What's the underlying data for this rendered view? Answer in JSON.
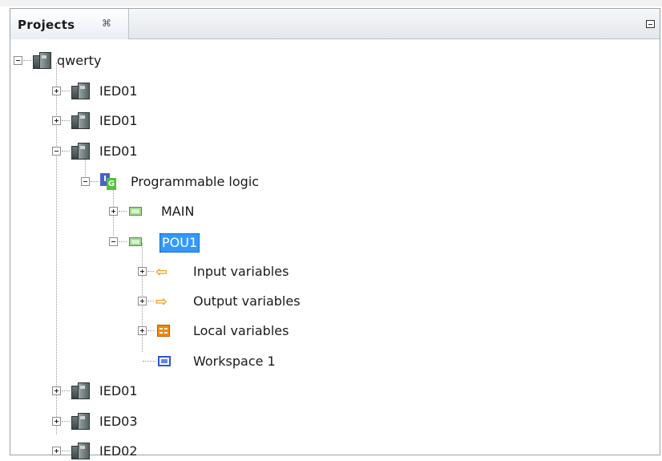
{
  "panel": {
    "tab_title": "Projects",
    "tab_close_glyph": "⌘",
    "minimize_icon": "minimize-icon"
  },
  "tree": {
    "root": {
      "label": "qwerty",
      "icon": "ied-icon",
      "expanded": true
    },
    "items": [
      {
        "label": "IED01",
        "icon": "ied-icon",
        "expanded": false
      },
      {
        "label": "IED01",
        "icon": "ied-icon",
        "expanded": false
      },
      {
        "label": "IED01",
        "icon": "ied-icon",
        "expanded": true
      },
      {
        "label": "Programmable logic",
        "icon": "programmable-logic-icon",
        "expanded": true
      },
      {
        "label": "MAIN",
        "icon": "pou-icon",
        "expanded": false
      },
      {
        "label": "POU1",
        "icon": "pou-icon",
        "expanded": true,
        "selected": true
      },
      {
        "label": "Input variables",
        "icon": "input-arrow-icon",
        "expanded": false
      },
      {
        "label": "Output variables",
        "icon": "output-arrow-icon",
        "expanded": false
      },
      {
        "label": "Local variables",
        "icon": "local-variables-icon",
        "expanded": false
      },
      {
        "label": "Workspace 1",
        "icon": "workspace-icon"
      },
      {
        "label": "IED01",
        "icon": "ied-icon",
        "expanded": false
      },
      {
        "label": "IED03",
        "icon": "ied-icon",
        "expanded": false
      },
      {
        "label": "IED02",
        "icon": "ied-icon",
        "expanded": false
      }
    ]
  },
  "colors": {
    "selection": "#3399ff",
    "header_top": "#f6f7f9",
    "header_bottom": "#e3e7ec"
  }
}
